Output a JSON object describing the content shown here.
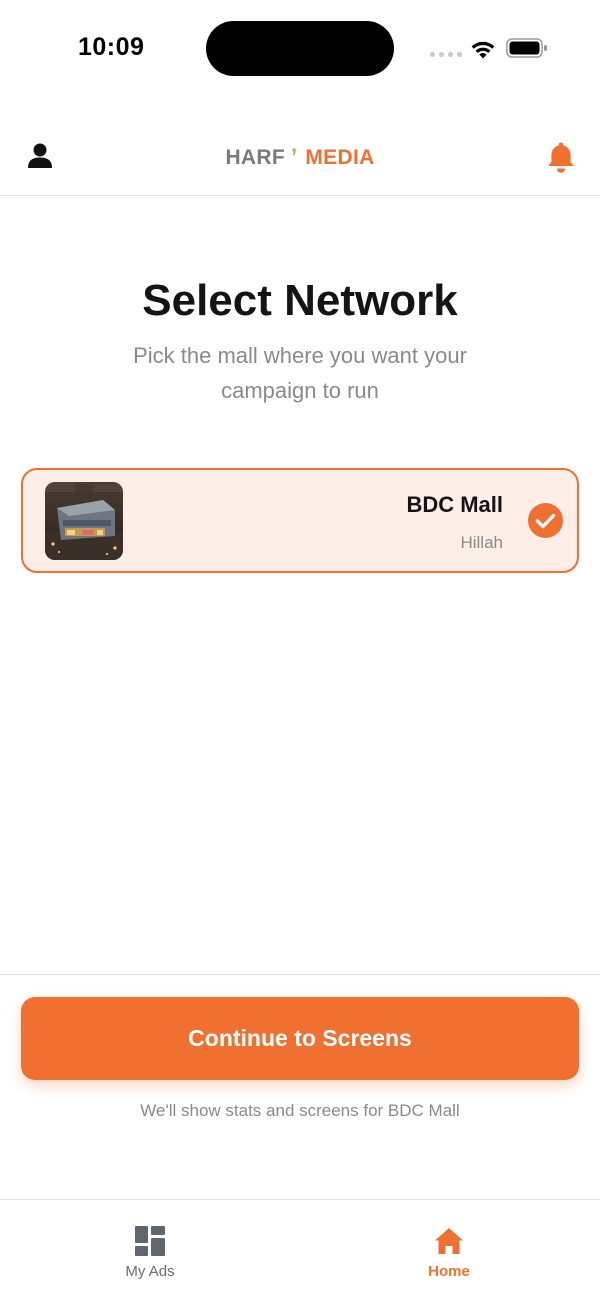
{
  "status_bar": {
    "time": "10:09",
    "icons": [
      "signal-icon",
      "wifi-icon",
      "battery-icon"
    ]
  },
  "header": {
    "brand_part_1": "HARF",
    "brand_mark": "’",
    "brand_part_2": "MEDIA",
    "left_icon": "profile-icon",
    "right_icon": "bell-icon"
  },
  "page": {
    "title": "Select Network",
    "subtitle": "Pick the mall where you want your campaign to run"
  },
  "networks": [
    {
      "name": "BDC Mall",
      "city": "Hillah",
      "selected": true,
      "thumbnail_icon": "mall-photo",
      "status_icon": "check-circle-icon"
    }
  ],
  "actions": {
    "continue_label": "Continue to Screens",
    "hint": "We'll show stats and screens for BDC Mall"
  },
  "tab_bar": {
    "items": [
      {
        "label": "My Ads",
        "icon": "dashboard-icon",
        "active": false
      },
      {
        "label": "Home",
        "icon": "home-icon",
        "active": true
      }
    ]
  },
  "colors": {
    "accent": "#ef7030",
    "accent_light": "#fdeee8",
    "brand_mark": "#8cc63f",
    "text_primary": "#141414",
    "text_secondary": "#8a8a8a",
    "divider": "#e4e4e4"
  }
}
